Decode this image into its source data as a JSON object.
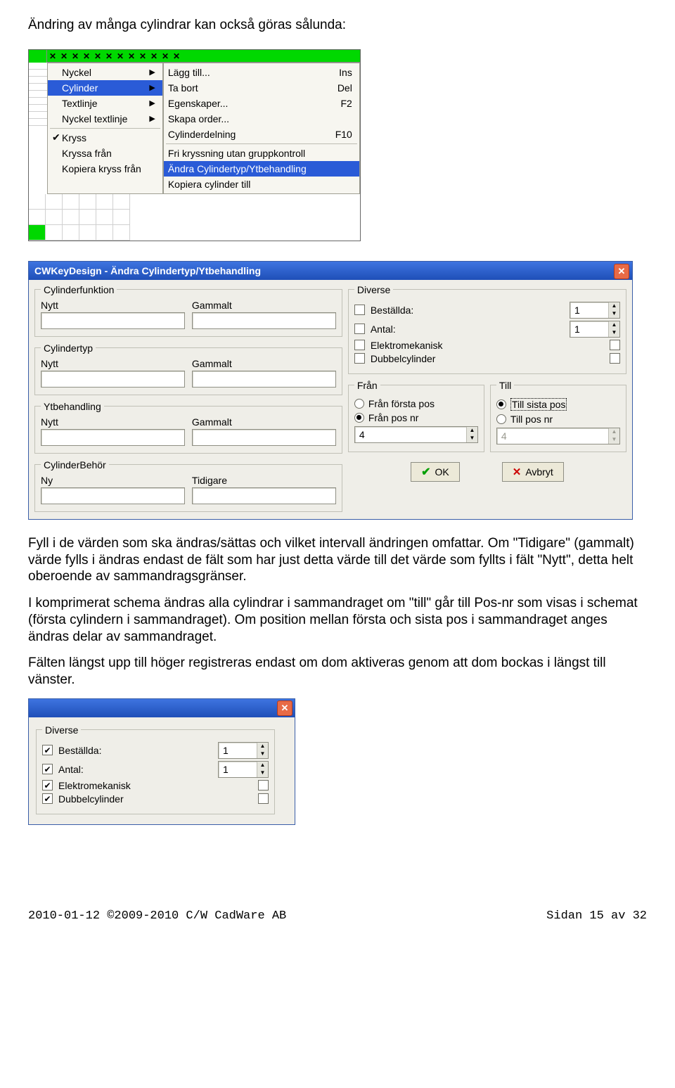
{
  "para_intro": "Ändring av många cylindrar kan också göras sålunda:",
  "ctx": {
    "col1": [
      {
        "chk": "",
        "label": "Nyckel",
        "arrow": true
      },
      {
        "chk": "",
        "label": "Cylinder",
        "arrow": true,
        "sel": true
      },
      {
        "chk": "",
        "label": "Textlinje",
        "arrow": true
      },
      {
        "chk": "",
        "label": "Nyckel textlinje",
        "arrow": true
      }
    ],
    "col1b": [
      {
        "chk": "✔",
        "label": "Kryss"
      },
      {
        "chk": "",
        "label": "Kryssa från"
      },
      {
        "chk": "",
        "label": "Kopiera kryss från"
      }
    ],
    "col2": [
      {
        "label": "Lägg till...",
        "sc": "Ins"
      },
      {
        "label": "Ta bort",
        "sc": "Del"
      },
      {
        "label": "Egenskaper...",
        "sc": "F2"
      },
      {
        "label": "Skapa order...",
        "sc": ""
      },
      {
        "label": "Cylinderdelning",
        "sc": "F10"
      }
    ],
    "col2b": [
      {
        "label": "Fri kryssning utan gruppkontroll"
      },
      {
        "label": "Ändra Cylindertyp/Ytbehandling",
        "sel": true
      },
      {
        "label": "Kopiera cylinder till"
      }
    ]
  },
  "dlg": {
    "title": "CWKeyDesign - Ändra Cylindertyp/Ytbehandling",
    "g_cylfunk": "Cylinderfunktion",
    "g_cyltyp": "Cylindertyp",
    "g_yt": "Ytbehandling",
    "g_cylbehor": "CylinderBehör",
    "lbl_nytt": "Nytt",
    "lbl_gammalt": "Gammalt",
    "lbl_ny": "Ny",
    "lbl_tidigare": "Tidigare",
    "g_diverse": "Diverse",
    "d_best": "Beställda:",
    "d_antal": "Antal:",
    "d_elektro": "Elektromekanisk",
    "d_dubbel": "Dubbelcylinder",
    "v1": "1",
    "g_fran": "Från",
    "g_till": "Till",
    "r_fran_forsta": "Från första pos",
    "r_fran_posnr": "Från pos nr",
    "r_till_sista": "Till sista pos",
    "r_till_posnr": "Till pos nr",
    "fran_val": "4",
    "till_val": "4",
    "btn_ok": "OK",
    "btn_avbryt": "Avbryt"
  },
  "para_fill": "Fyll i de värden som ska ändras/sättas och vilket intervall ändringen omfattar. Om \"Tidigare\" (gammalt) värde fylls i ändras endast de fält som har just detta värde till det värde som fyllts i fält \"Nytt\", detta helt oberoende av sammandragsgränser.",
  "para_komp": "I komprimerat schema ändras alla cylindrar i sammandraget om \"till\" går till Pos-nr som visas i schemat (första cylindern i sammandraget). Om position mellan första och sista pos i sammandraget anges ändras delar av sammandraget.",
  "para_falt": "Fälten längst upp till höger registreras endast om dom aktiveras genom att dom bockas i längst till vänster.",
  "dlg2": {
    "g_diverse": "Diverse",
    "d_best": "Beställda:",
    "d_antal": "Antal:",
    "d_elektro": "Elektromekanisk",
    "d_dubbel": "Dubbelcylinder",
    "v1": "1"
  },
  "footer_left": "2010-01-12 ©2009-2010 C/W CadWare AB",
  "footer_right": "Sidan 15 av 32"
}
